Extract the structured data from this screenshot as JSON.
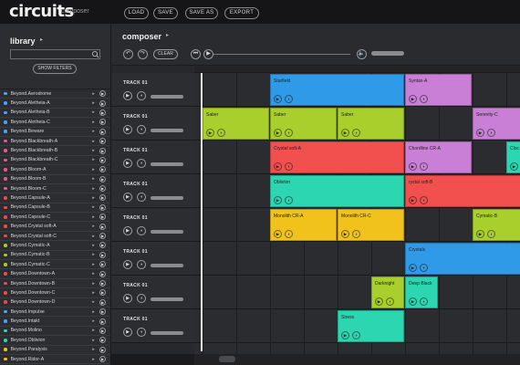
{
  "app": {
    "logo": "circuits",
    "subtitle": "composer"
  },
  "toolbar": {
    "load": "LOAD",
    "save": "SAVE",
    "save_as": "SAVE AS",
    "export": "EXPORT"
  },
  "library": {
    "title": "library",
    "search_placeholder": "",
    "show_filters": "SHOW FILTERS",
    "items": [
      {
        "name": "Beyond.Aerodrome",
        "color": "#4aa3ff"
      },
      {
        "name": "Beyond.Aletheia-A",
        "color": "#4aa3ff"
      },
      {
        "name": "Beyond.Aletheia-B",
        "color": "#4aa3ff"
      },
      {
        "name": "Beyond.Aletheia-C",
        "color": "#4aa3ff"
      },
      {
        "name": "Beyond.Beware",
        "color": "#4aa3ff"
      },
      {
        "name": "Beyond.Blackbreath-A",
        "color": "#e85a8e"
      },
      {
        "name": "Beyond.Blackbreath-B",
        "color": "#e85a8e"
      },
      {
        "name": "Beyond.Blackbreath-C",
        "color": "#e85a8e"
      },
      {
        "name": "Beyond.Bloom-A",
        "color": "#e85a8e"
      },
      {
        "name": "Beyond.Bloom-B",
        "color": "#e85a8e"
      },
      {
        "name": "Beyond.Bloom-C",
        "color": "#e85a8e"
      },
      {
        "name": "Beyond.Capsule-A",
        "color": "#ef4a4a"
      },
      {
        "name": "Beyond.Capsule-B",
        "color": "#ef4a4a"
      },
      {
        "name": "Beyond.Capsule-C",
        "color": "#ef4a4a"
      },
      {
        "name": "Beyond.Crystal soft-A",
        "color": "#ef4a4a"
      },
      {
        "name": "Beyond.Crystal soft-C",
        "color": "#ef4a4a"
      },
      {
        "name": "Beyond.Cymatic-A",
        "color": "#a6cf2a"
      },
      {
        "name": "Beyond.Cymatic-B",
        "color": "#a6cf2a"
      },
      {
        "name": "Beyond.Cymatic-C",
        "color": "#a6cf2a"
      },
      {
        "name": "Beyond.Downtown-A",
        "color": "#ef4a4a"
      },
      {
        "name": "Beyond.Downtown-B",
        "color": "#ef4a4a"
      },
      {
        "name": "Beyond.Downtown-C",
        "color": "#ef4a4a"
      },
      {
        "name": "Beyond.Downtown-D",
        "color": "#ef4a4a"
      },
      {
        "name": "Beyond.Impulse",
        "color": "#4aa3ff"
      },
      {
        "name": "Beyond.Intakt",
        "color": "#4aa3ff"
      },
      {
        "name": "Beyond.Molino",
        "color": "#2bd6b0"
      },
      {
        "name": "Beyond.Oblivion",
        "color": "#2bd6b0"
      },
      {
        "name": "Beyond.Paralysis",
        "color": "#f2c21c"
      },
      {
        "name": "Beyond.Ridor-A",
        "color": "#f2c21c"
      },
      {
        "name": "Beyond.Ridor-B",
        "color": "#f2c21c"
      }
    ]
  },
  "composer": {
    "title": "composer",
    "clear": "CLEAR",
    "tracks": [
      {
        "label": "TRACK 01"
      },
      {
        "label": "TRACK 01"
      },
      {
        "label": "TRACK 01"
      },
      {
        "label": "TRACK 01"
      },
      {
        "label": "TRACK 01"
      },
      {
        "label": "TRACK 01"
      },
      {
        "label": "TRACK 01"
      },
      {
        "label": "TRACK 01"
      }
    ],
    "clips": [
      {
        "name": "Starfield",
        "lane": 0,
        "start": 3,
        "len": 4,
        "color": "#2f9be8"
      },
      {
        "name": "Syntax-A",
        "lane": 0,
        "start": 7,
        "len": 2,
        "color": "#c97fd6"
      },
      {
        "name": "Saber",
        "lane": 1,
        "start": 1,
        "len": 2,
        "color": "#a8cf2b"
      },
      {
        "name": "Saber",
        "lane": 1,
        "start": 3,
        "len": 2,
        "color": "#a8cf2b"
      },
      {
        "name": "Saber",
        "lane": 1,
        "start": 5,
        "len": 2,
        "color": "#a8cf2b"
      },
      {
        "name": "Serenity-C",
        "lane": 1,
        "start": 9,
        "len": 2,
        "color": "#c97fd6"
      },
      {
        "name": "Crystal soft-A",
        "lane": 2,
        "start": 3,
        "len": 4,
        "color": "#f24f4f"
      },
      {
        "name": "Chordline CR-A",
        "lane": 2,
        "start": 7,
        "len": 2,
        "color": "#c97fd6"
      },
      {
        "name": "Cloc",
        "lane": 2,
        "start": 10,
        "len": 1,
        "color": "#2bd6b0"
      },
      {
        "name": "Oblivion",
        "lane": 3,
        "start": 3,
        "len": 4,
        "color": "#2bd6b0"
      },
      {
        "name": "rystal soft-B",
        "lane": 3,
        "start": 7,
        "len": 4,
        "color": "#f24f4f"
      },
      {
        "name": "Monolith CR-A",
        "lane": 4,
        "start": 3,
        "len": 2,
        "color": "#f2c21c"
      },
      {
        "name": "Monolith CR-C",
        "lane": 4,
        "start": 5,
        "len": 2,
        "color": "#f2c21c"
      },
      {
        "name": "Cymatic-B",
        "lane": 4,
        "start": 9,
        "len": 2,
        "color": "#a8cf2b"
      },
      {
        "name": "Crystals",
        "lane": 5,
        "start": 7,
        "len": 4,
        "color": "#2f9be8"
      },
      {
        "name": "Darknight",
        "lane": 6,
        "start": 6,
        "len": 1,
        "color": "#a8cf2b"
      },
      {
        "name": "Deep Black",
        "lane": 6,
        "start": 7,
        "len": 1,
        "color": "#2bd6b0"
      },
      {
        "name": "Stress",
        "lane": 7,
        "start": 5,
        "len": 2,
        "color": "#2bd6b0"
      }
    ]
  }
}
